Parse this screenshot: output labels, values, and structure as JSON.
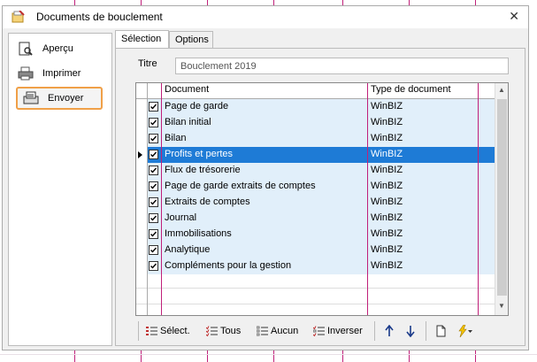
{
  "window": {
    "title": "Documents de bouclement",
    "close_glyph": "✕"
  },
  "sidebar": {
    "items": [
      {
        "label": "Aperçu",
        "icon": "preview-icon"
      },
      {
        "label": "Imprimer",
        "icon": "printer-icon"
      },
      {
        "label": "Envoyer",
        "icon": "send-icon"
      }
    ],
    "highlight_color": "#f0a048"
  },
  "tabs": [
    {
      "label": "Sélection"
    },
    {
      "label": "Options"
    }
  ],
  "form": {
    "titre_label": "Titre",
    "titre_value": "Bouclement 2019"
  },
  "grid": {
    "headers": {
      "document": "Document",
      "type": "Type de document"
    },
    "rows": [
      {
        "document": "Page de garde",
        "type": "WinBIZ",
        "checked": true
      },
      {
        "document": "Bilan initial",
        "type": "WinBIZ",
        "checked": true
      },
      {
        "document": "Bilan",
        "type": "WinBIZ",
        "checked": true
      },
      {
        "document": "Profits et pertes",
        "type": "WinBIZ",
        "checked": true,
        "selected": true
      },
      {
        "document": "Flux de trésorerie",
        "type": "WinBIZ",
        "checked": true
      },
      {
        "document": "Page de garde extraits de comptes",
        "type": "WinBIZ",
        "checked": true
      },
      {
        "document": "Extraits de comptes",
        "type": "WinBIZ",
        "checked": true
      },
      {
        "document": "Journal",
        "type": "WinBIZ",
        "checked": true
      },
      {
        "document": "Immobilisations",
        "type": "WinBIZ",
        "checked": true
      },
      {
        "document": "Analytique",
        "type": "WinBIZ",
        "checked": true
      },
      {
        "document": "Compléments pour la gestion",
        "type": "WinBIZ",
        "checked": true
      }
    ],
    "selection_color": "#1e7bd6",
    "row_color": "#e1effa"
  },
  "toolbar": {
    "select_label": "Sélect.",
    "all_label": "Tous",
    "none_label": "Aucun",
    "invert_label": "Inverser"
  }
}
